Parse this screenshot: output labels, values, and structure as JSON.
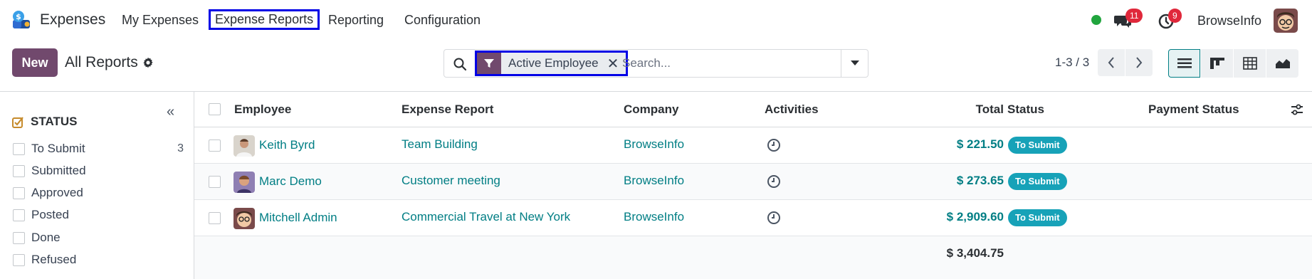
{
  "app": {
    "name": "Expenses"
  },
  "nav": {
    "my_expenses": "My Expenses",
    "expense_reports": "Expense Reports",
    "reporting": "Reporting",
    "configuration": "Configuration"
  },
  "systray": {
    "messages_count": "11",
    "activities_count": "9",
    "user_name": "BrowseInfo"
  },
  "control": {
    "new_label": "New",
    "breadcrumb": "All Reports",
    "facet_label": "Active Employee",
    "facet_close": "✕",
    "search_placeholder": "Search...",
    "pager": "1-3 / 3"
  },
  "sidebar": {
    "collapse": "«",
    "section_title": "STATUS",
    "items": [
      {
        "label": "To Submit",
        "count": "3"
      },
      {
        "label": "Submitted",
        "count": ""
      },
      {
        "label": "Approved",
        "count": ""
      },
      {
        "label": "Posted",
        "count": ""
      },
      {
        "label": "Done",
        "count": ""
      },
      {
        "label": "Refused",
        "count": ""
      }
    ]
  },
  "table": {
    "columns": {
      "employee": "Employee",
      "expense_report": "Expense Report",
      "company": "Company",
      "activities": "Activities",
      "total": "Total",
      "status": "Status",
      "payment_status": "Payment Status"
    },
    "rows": [
      {
        "employee": "Keith Byrd",
        "report": "Team Building",
        "company": "BrowseInfo",
        "total": "$ 221.50",
        "status": "To Submit"
      },
      {
        "employee": "Marc Demo",
        "report": "Customer meeting",
        "company": "BrowseInfo",
        "total": "$ 273.65",
        "status": "To Submit"
      },
      {
        "employee": "Mitchell Admin",
        "report": "Commercial Travel at New York",
        "company": "BrowseInfo",
        "total": "$ 2,909.60",
        "status": "To Submit"
      }
    ],
    "grand_total": "$ 3,404.75"
  },
  "colors": {
    "brand": "#71496d",
    "link": "#017e84",
    "status_pill": "#17a2b8",
    "badge": "#e0283b",
    "online": "#21a53e",
    "highlight_box": "#0000e6"
  },
  "icons": [
    "expenses-app-icon",
    "chat-icon",
    "clock-icon",
    "gear-icon",
    "search-icon",
    "filter-icon",
    "caret-down-icon",
    "chevron-left-icon",
    "chevron-right-icon",
    "list-view-icon",
    "kanban-view-icon",
    "pivot-view-icon",
    "graph-view-icon",
    "optional-columns-icon"
  ]
}
